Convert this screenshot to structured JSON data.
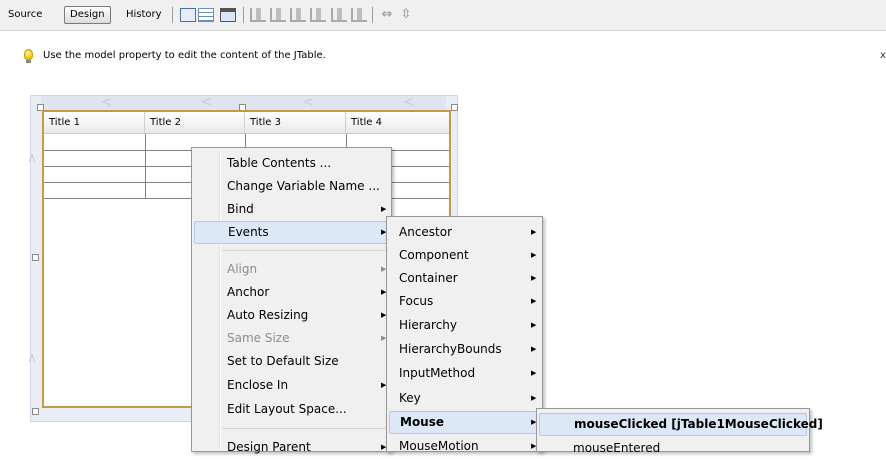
{
  "toolbar": {
    "tabs": [
      "Source",
      "Design",
      "History"
    ],
    "active_tab": "Design"
  },
  "hint": {
    "text": "Use the model property to edit the content of the JTable.",
    "close": "x"
  },
  "table": {
    "columns": [
      "Title 1",
      "Title 2",
      "Title 3",
      "Title 4"
    ]
  },
  "context_menu": {
    "items": [
      {
        "label": "Table Contents ...",
        "submenu": false,
        "disabled": false
      },
      {
        "label": "Change Variable Name ...",
        "submenu": false,
        "disabled": false
      },
      {
        "label": "Bind",
        "submenu": true,
        "disabled": false
      },
      {
        "label": "Events",
        "submenu": true,
        "disabled": false,
        "highlighted": true
      },
      {
        "label": "Align",
        "submenu": true,
        "disabled": true
      },
      {
        "label": "Anchor",
        "submenu": true,
        "disabled": false
      },
      {
        "label": "Auto Resizing",
        "submenu": true,
        "disabled": false
      },
      {
        "label": "Same Size",
        "submenu": true,
        "disabled": true
      },
      {
        "label": "Set to Default Size",
        "submenu": false,
        "disabled": false
      },
      {
        "label": "Enclose In",
        "submenu": true,
        "disabled": false
      },
      {
        "label": "Edit Layout Space...",
        "submenu": false,
        "disabled": false
      },
      {
        "label": "Design Parent",
        "submenu": true,
        "disabled": false
      }
    ]
  },
  "events_menu": {
    "items": [
      "Ancestor",
      "Component",
      "Container",
      "Focus",
      "Hierarchy",
      "HierarchyBounds",
      "InputMethod",
      "Key",
      "Mouse",
      "MouseMotion"
    ],
    "highlighted": "Mouse"
  },
  "mouse_menu": {
    "items": [
      "mouseClicked [jTable1MouseClicked]",
      "mouseEntered"
    ],
    "highlighted": "mouseClicked [jTable1MouseClicked]"
  },
  "colors": {
    "highlight": "#dce8f7",
    "selection_border": "#c69a44",
    "menu_background": "#f0f0f0"
  }
}
